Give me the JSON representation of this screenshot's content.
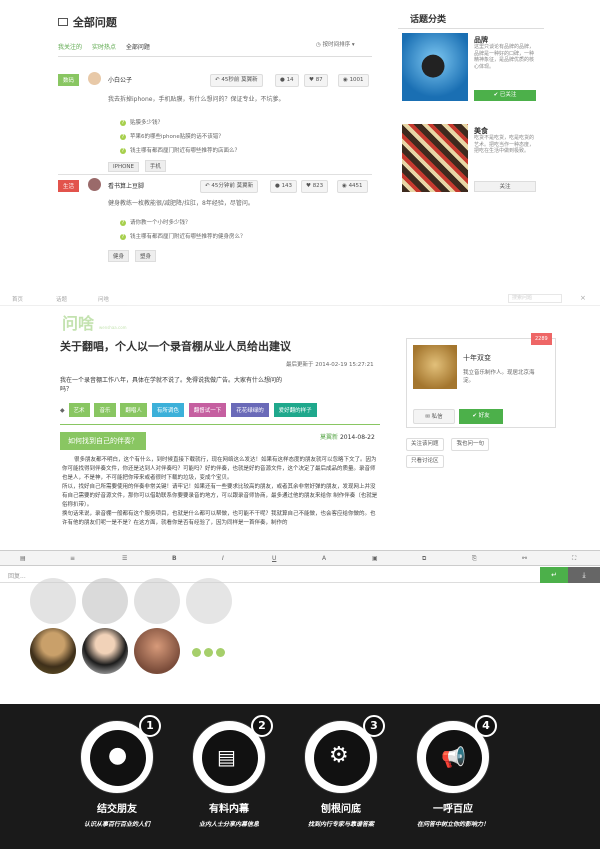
{
  "list": {
    "title": "全部问题",
    "tabs": [
      "我关注的",
      "实时热点",
      "全部问题"
    ],
    "sort": "按时间排序",
    "items": [
      {
        "category": "数码",
        "cat_color": "#89c662",
        "user": "小白公子",
        "invite": "45秒前 莫翼新",
        "answers": "14",
        "likes": "87",
        "views": "1001",
        "question": "我去拆掉iphone，手机贴膜，有什么想问的？保证专业，不坑爹。",
        "subs": [
          "贴膜多少钱？",
          "苹果6的哪些iphone贴膜的话不该错？",
          "钱主哪有都西厘门附近有哪些推荐的店面么？"
        ],
        "tags": [
          "IPHONE",
          "手机"
        ]
      },
      {
        "category": "生活",
        "cat_color": "#e2534c",
        "user": "看书算上豆脚",
        "invite": "45分钟前 莫翼新",
        "answers": "143",
        "likes": "823",
        "views": "4451",
        "question": "健身教练一枚教能很/减肥降/拉肛，8年经验，尽管问。",
        "subs": [
          "请你教一个小时多少钱？",
          "钱主哪有都西厘门附近有哪些推荐的健身房么？"
        ],
        "tags": [
          "健身",
          "塑身"
        ]
      }
    ]
  },
  "sidebar": {
    "title": "话题分类",
    "topics": [
      {
        "name": "品牌",
        "desc": "这里只谈论有品牌的品牌，品牌是一种好的口碑，一种精神象征，是品牌优质的核心体现。",
        "button": "已关注"
      },
      {
        "name": "美食",
        "desc": "吃货不是吃货，吃是吃货的艺术。把吃当作一种态度，把吃在生活中做到极致。",
        "button": "关注"
      }
    ]
  },
  "article": {
    "nav": [
      "首页",
      "话题",
      "问啥"
    ],
    "search": "搜索问题",
    "logo": "问啥",
    "logo_sub": "wenshaa.com",
    "title": "关于翻唱，个人以一个录音棚从业人员给出建议",
    "meta": "最后更新于 2014-02-19 15:27:21",
    "body": "我在一个录音棚工作八年，具体在学就不说了。免得说我做广告。大家有什么想问的吗？",
    "tags": [
      {
        "t": "艺术",
        "c": "#89c662"
      },
      {
        "t": "音乐",
        "c": "#89c662"
      },
      {
        "t": "翻唱人",
        "c": "#89c662"
      },
      {
        "t": "有所调色",
        "c": "#3cb0d9"
      },
      {
        "t": "翻督试一下",
        "c": "#c55fa0"
      },
      {
        "t": "花花绿绿的",
        "c": "#6a6ab8"
      },
      {
        "t": "爱好翻的样子",
        "c": "#1fa88c"
      }
    ],
    "answer_title": "如何找到自己的伴奏？",
    "answer_user": "莫翼新",
    "answer_date": "2014-08-22",
    "answer_text": [
      "很多朋友都不明白，这个有什么，到时候直接下载就行，现在网络这么发达！如果有这样态度的朋友就可以忽略下文了。因为你可能找得到伴奏文件，你还是达到人对伴奏吗？可能吗？好的伴奏，也就是好的音源文件，这个决定了最后成品的质量。录音师也是人，不是神，不可能把你带来或者很时下载的垃圾，变成个宝贝。",
      "所以，找好自己所需要使用的伴奏非常关键！请牢记！如果还有一些要求比较高的朋友，或者其余非常好弹的朋友，发现网上并没有自己需要的好音源文件，那你可以借助联系你要要录音的地方，可以跟录音师协商，最多通过他的朋友来给你 制作伴奏（也就是俗称扒带）。",
      "换句话来说，录音棚一般都有这个服务项目，也就是什么都可以帮做，也可能不干呢？我就算自己不能做，也会客应给你做的。也许有他的朋友们呢一是不是？在这方面，就看你是否有经验了，因为同样是一首伴奏，制作的"
    ]
  },
  "author": {
    "badge": "2289",
    "name": "十年双变",
    "bio": "我立音乐制作人。现居北京海淀。",
    "message": "私信",
    "follow": "好友",
    "links": [
      "关注该问题",
      "我也问一句",
      "只看讨论区"
    ]
  },
  "editor": {
    "placeholder": "回复..."
  },
  "features": [
    {
      "num": "1",
      "title": "结交朋友",
      "sub": "认识从事百行百业的人们"
    },
    {
      "num": "2",
      "title": "有料内幕",
      "sub": "业内人士分享内幕信息"
    },
    {
      "num": "3",
      "title": "刨根问底",
      "sub": "找到内行专家与靠谱答案"
    },
    {
      "num": "4",
      "title": "一呼百应",
      "sub": "在问答中树立你的影响力！"
    }
  ]
}
